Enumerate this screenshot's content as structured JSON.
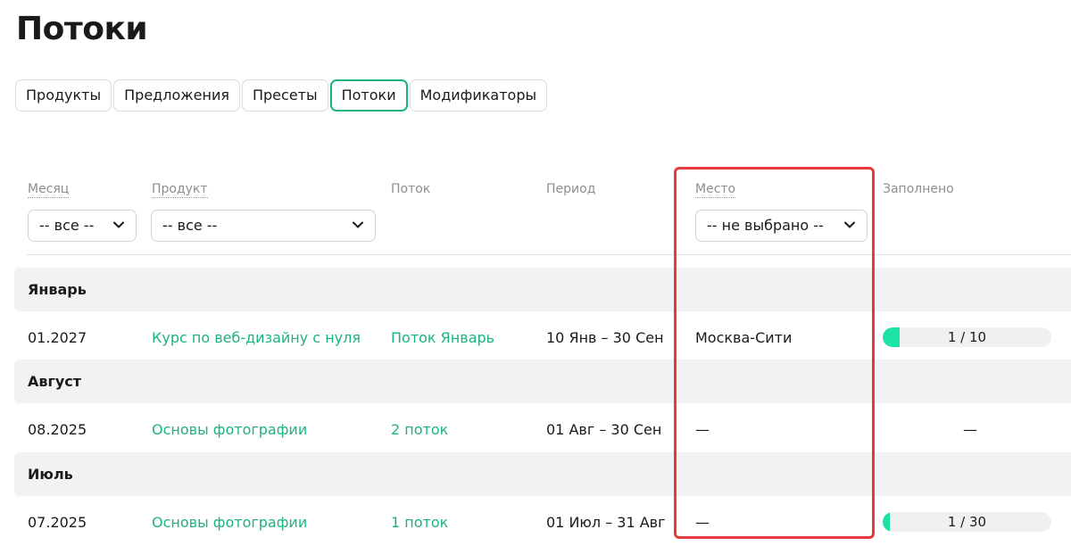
{
  "page": {
    "title": "Потоки"
  },
  "tabs": [
    {
      "label": "Продукты",
      "active": false
    },
    {
      "label": "Предложения",
      "active": false
    },
    {
      "label": "Пресеты",
      "active": false
    },
    {
      "label": "Потоки",
      "active": true
    },
    {
      "label": "Модификаторы",
      "active": false
    }
  ],
  "columns": {
    "month": "Месяц",
    "product": "Продукт",
    "stream": "Поток",
    "period": "Период",
    "place": "Место",
    "filled": "Заполнено"
  },
  "filters": {
    "month": "-- все --",
    "product": "-- все --",
    "place": "-- не выбрано --"
  },
  "groups": [
    {
      "label": "Январь",
      "row": {
        "month": "01.2027",
        "product": "Курс по веб-дизайну с нуля",
        "stream": "Поток Январь",
        "period": "10 Янв – 30 Сен",
        "place": "Москва-Сити",
        "filled_text": "1 / 10",
        "filled_fraction": 0.1
      }
    },
    {
      "label": "Август",
      "row": {
        "month": "08.2025",
        "product": "Основы фотографии",
        "stream": "2 поток",
        "period": "01 Авг – 30 Сен",
        "place": "—",
        "filled_text": "—",
        "filled_fraction": null
      }
    },
    {
      "label": "Июль",
      "row": {
        "month": "07.2025",
        "product": "Основы фотографии",
        "stream": "1 поток",
        "period": "01 Июл – 31 Авг",
        "place": "—",
        "filled_text": "1 / 30",
        "filled_fraction": 0.0333
      }
    }
  ],
  "colors": {
    "accent": "#1bb37e",
    "progress": "#1de2a6",
    "highlight": "#e53b3b"
  }
}
